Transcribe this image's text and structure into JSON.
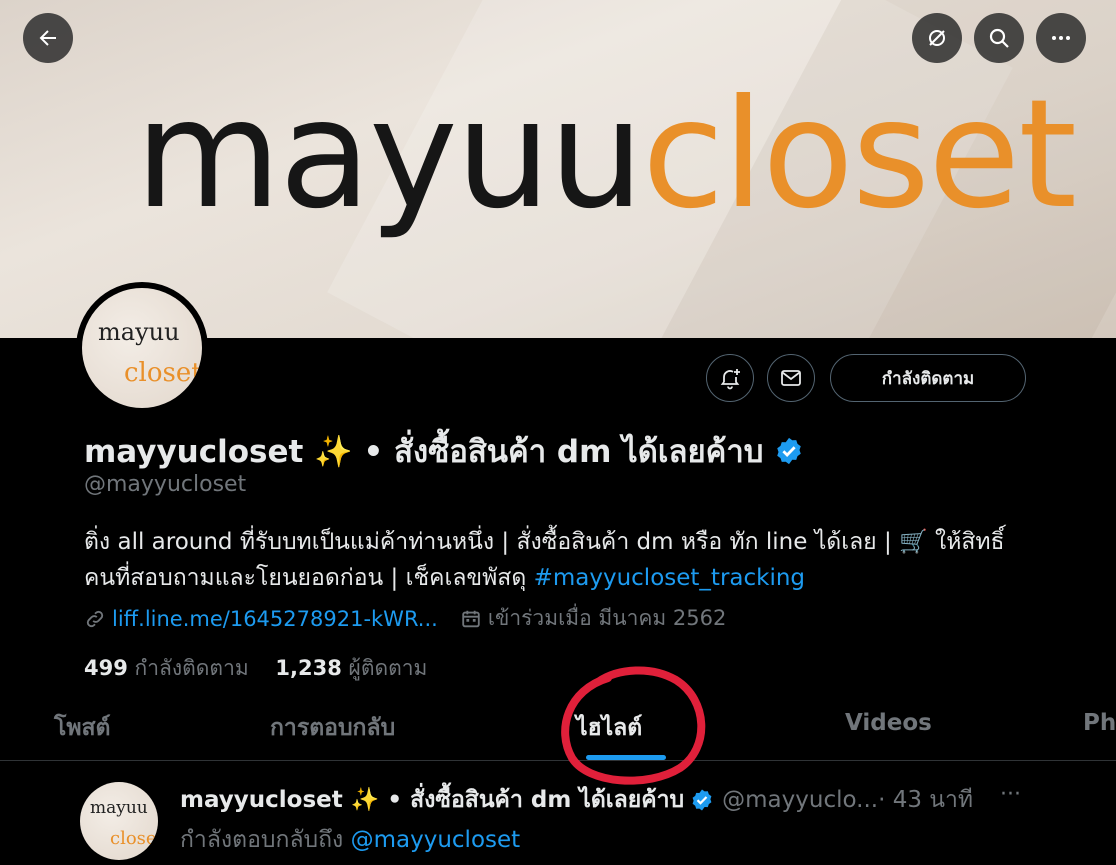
{
  "banner": {
    "logo_part1": "mayuu",
    "logo_part2": "closet"
  },
  "top_buttons": {
    "back_icon": "arrow-left-icon",
    "grok_icon": "grok-icon",
    "search_icon": "search-icon",
    "more_icon": "more-horizontal-icon"
  },
  "avatar": {
    "line1": "mayuu",
    "line2": "closet"
  },
  "actions": {
    "notify_icon": "bell-plus-icon",
    "message_icon": "envelope-icon",
    "follow_label": "กำลังติดตาม"
  },
  "profile": {
    "display_name": "mayyucloset ✨ • สั่งซื้อสินค้า dm ได้เลยค้าบ",
    "handle": "@mayyucloset",
    "bio_text": "ติ่ง all around ที่รับบทเป็นแม่ค้าท่านหนึ่ง | สั่งซื้อสินค้า dm หรือ ทัก line ได้เลย | 🛒 ให้สิทธิ์คนที่สอบถามและโยนยอดก่อน | เช็คเลขพัสดุ ",
    "bio_hashtag": "#mayyucloset_tracking",
    "link": "liff.line.me/1645278921-kWR...",
    "joined": "เข้าร่วมเมื่อ มีนาคม 2562",
    "following_count": "499",
    "following_label": "กำลังติดตาม",
    "followers_count": "1,238",
    "followers_label": "ผู้ติดตาม",
    "accent_color": "#1d9bf0"
  },
  "tabs": [
    {
      "label": "โพสต์"
    },
    {
      "label": "การตอบกลับ"
    },
    {
      "label": "ไฮไลต์",
      "active": true
    },
    {
      "label": "Videos"
    },
    {
      "label": "Ph"
    }
  ],
  "post": {
    "avatar_line1": "mayuu",
    "avatar_line2": "closet",
    "name": "mayyucloset ✨ • สั่งซื้อสินค้า dm ได้เลยค้าบ",
    "handle": "@mayyuclo...",
    "time": " · 43 นาที",
    "more": "···",
    "reply_prefix": "กำลังตอบกลับถึง ",
    "reply_handle": "@mayyucloset"
  }
}
